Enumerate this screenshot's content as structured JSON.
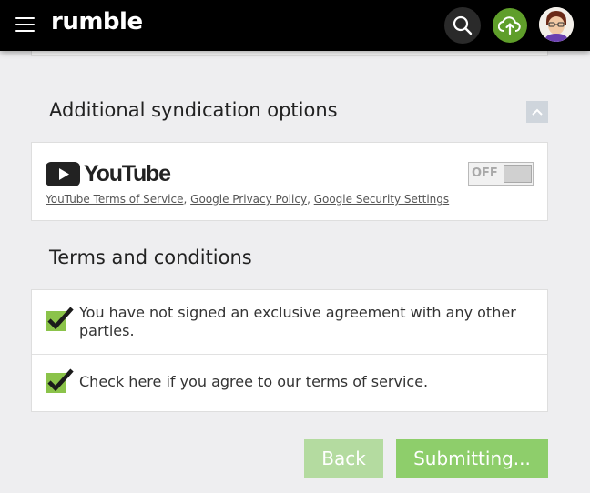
{
  "header": {
    "logo_text": "rumble",
    "icons": [
      "menu-icon",
      "search-icon",
      "upload-icon",
      "user-avatar"
    ],
    "colors": {
      "bar": "#000000",
      "upload": "#5f9e2a"
    }
  },
  "syndication": {
    "title": "Additional syndication options",
    "youtube": {
      "brand": "YouTube",
      "links": [
        "YouTube Terms of Service",
        "Google Privacy Policy",
        "Google Security Settings"
      ],
      "toggle_label": "OFF"
    }
  },
  "terms": {
    "title": "Terms and conditions",
    "items": [
      {
        "text": "You have not signed an exclusive agreement with any other parties.",
        "checked": true
      },
      {
        "text": "Check here if you agree to our terms of service.",
        "checked": true
      }
    ]
  },
  "actions": {
    "back_label": "Back",
    "submit_label": "Submitting..."
  },
  "colors": {
    "accent": "#8ece6b",
    "accent_light": "#b4dba0",
    "checkbox": "#8bc34a"
  }
}
